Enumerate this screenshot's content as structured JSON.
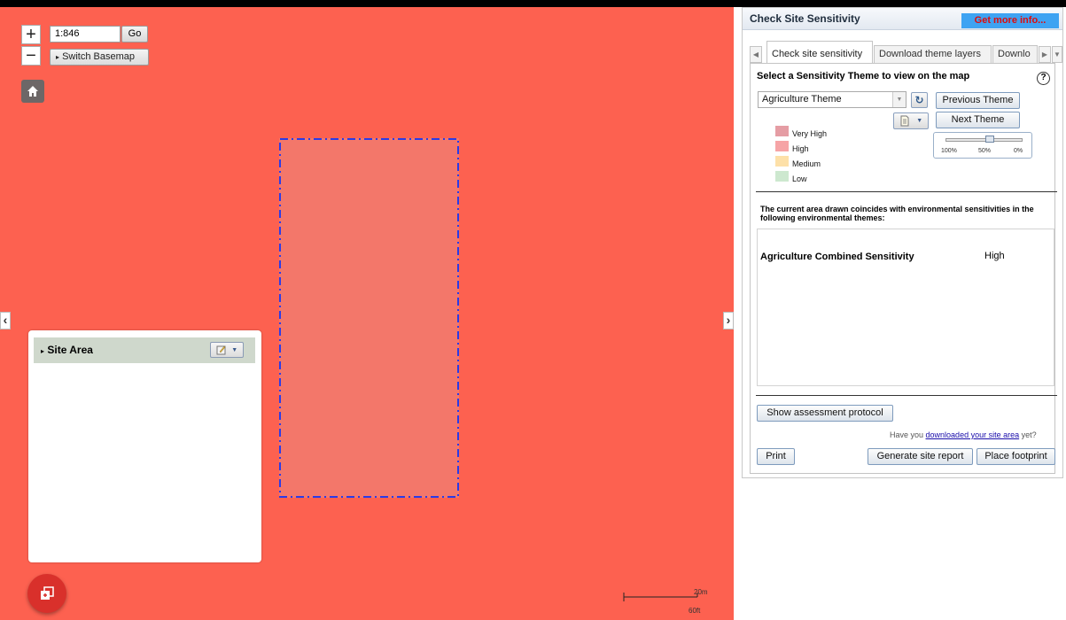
{
  "map": {
    "scale_value": "1:846",
    "go_label": "Go",
    "switch_basemap_label": "Switch Basemap",
    "zoom_in_label": "+",
    "zoom_out_label": "−",
    "collapse_left": "‹",
    "collapse_right": "›",
    "scalebar_top": "20m",
    "scalebar_bottom": "60ft",
    "map_color": "#fd6150"
  },
  "site_panel": {
    "header_label": "Site Area"
  },
  "panel": {
    "title": "Check Site Sensitivity",
    "more_info_label": "Get more info...",
    "tabs": [
      {
        "label": "Check site sensitivity"
      },
      {
        "label": "Download theme layers"
      },
      {
        "label": "Downlo"
      }
    ],
    "select_theme_label": "Select a Sensitivity Theme to view on the map",
    "help_label": "?",
    "theme_value": "Agriculture Theme",
    "previous_theme_label": "Previous Theme",
    "next_theme_label": "Next Theme",
    "legend": [
      {
        "label": "Very High",
        "color": "#e59da4"
      },
      {
        "label": "High",
        "color": "#f6a4a6"
      },
      {
        "label": "Medium",
        "color": "#fde0a8"
      },
      {
        "label": "Low",
        "color": "#cde8cf"
      }
    ],
    "transparency": {
      "value_percent": 50,
      "labels": [
        "100%",
        "50%",
        "0%"
      ]
    },
    "coincide_text": "The current area drawn coincides with environmental sensitivities in the following environmental themes:",
    "results": [
      {
        "name": "Agriculture Combined Sensitivity",
        "value": "High"
      }
    ],
    "show_protocol_label": "Show assessment protocol",
    "have_you_prefix": "Have you ",
    "have_you_link": "downloaded your site area",
    "have_you_suffix": " yet?",
    "print_label": "Print",
    "generate_report_label": "Generate site report",
    "place_footprint_label": "Place footprint"
  }
}
